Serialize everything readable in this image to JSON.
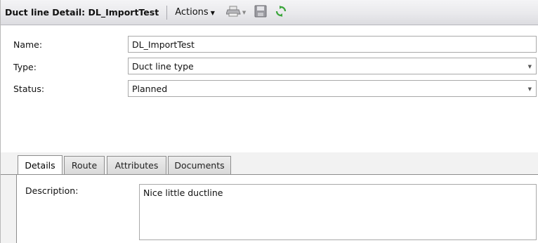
{
  "header": {
    "title": "Duct line Detail: DL_ImportTest",
    "actions_label": "Actions",
    "icons": [
      "print-icon",
      "save-icon",
      "refresh-icon"
    ]
  },
  "form": {
    "name_label": "Name:",
    "name_value": "DL_ImportTest",
    "type_label": "Type:",
    "type_value": "Duct line type",
    "status_label": "Status:",
    "status_value": "Planned"
  },
  "tabs": [
    {
      "label": "Details",
      "active": true
    },
    {
      "label": "Route",
      "active": false
    },
    {
      "label": "Attributes",
      "active": false
    },
    {
      "label": "Documents",
      "active": false
    }
  ],
  "details": {
    "description_label": "Description:",
    "description_value": "Nice little ductline"
  },
  "colors": {
    "refresh_icon": "#3aa53a",
    "border": "#a9a9a9"
  }
}
